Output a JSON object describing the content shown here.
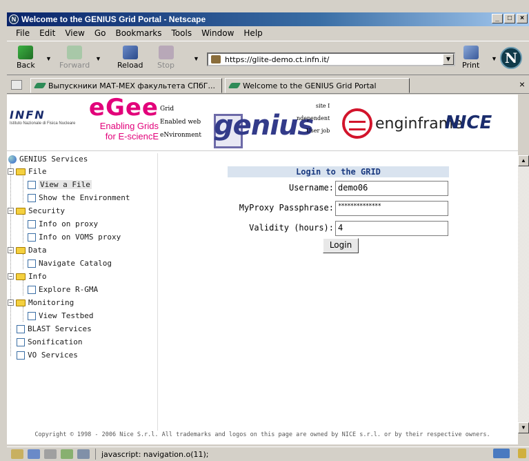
{
  "window": {
    "title": "Welcome to the GENIUS Grid Portal - Netscape",
    "buttons": [
      "_",
      "□",
      "×"
    ]
  },
  "menu": [
    "File",
    "Edit",
    "View",
    "Go",
    "Bookmarks",
    "Tools",
    "Window",
    "Help"
  ],
  "toolbar": {
    "back": "Back",
    "forward": "Forward",
    "reload": "Reload",
    "stop": "Stop",
    "url": "https://glite-demo.ct.infn.it/",
    "print": "Print"
  },
  "tabs": [
    {
      "label": "Выпускники МАТ-МЕХ факультета СПбГ...",
      "active": false
    },
    {
      "label": "Welcome to the GENIUS Grid Portal",
      "active": true
    }
  ],
  "banner": {
    "infn": "INFN",
    "infn_small": "Istituto Nazionale di Fisica Nucleare",
    "egee": "eGee",
    "egee_line1": "Enabling Grids",
    "egee_line2": "for E-sciencE",
    "grid_words": [
      "Grid",
      "Enabled web",
      "eNvironment"
    ],
    "genius": "genius",
    "site_words": [
      "site I",
      "ndependent",
      "User job"
    ],
    "enginframe": "enginframe",
    "nice": "NICE"
  },
  "sidebar": {
    "root": "GENIUS Services",
    "items": [
      {
        "label": "File",
        "type": "folder",
        "level": 1
      },
      {
        "label": "View a File",
        "type": "doc",
        "level": 2,
        "selected": true
      },
      {
        "label": "Show the Environment",
        "type": "doc",
        "level": 2
      },
      {
        "label": "Security",
        "type": "folder",
        "level": 1
      },
      {
        "label": "Info on proxy",
        "type": "doc",
        "level": 2
      },
      {
        "label": "Info on VOMS proxy",
        "type": "doc",
        "level": 2
      },
      {
        "label": "Data",
        "type": "folder",
        "level": 1
      },
      {
        "label": "Navigate Catalog",
        "type": "doc",
        "level": 2
      },
      {
        "label": "Info",
        "type": "folder",
        "level": 1
      },
      {
        "label": "Explore R-GMA",
        "type": "doc",
        "level": 2
      },
      {
        "label": "Monitoring",
        "type": "folder",
        "level": 1
      },
      {
        "label": "View Testbed",
        "type": "doc",
        "level": 2
      },
      {
        "label": "BLAST Services",
        "type": "doc",
        "level": 1
      },
      {
        "label": "Sonification",
        "type": "doc",
        "level": 1
      },
      {
        "label": "VO Services",
        "type": "doc",
        "level": 1
      }
    ]
  },
  "login": {
    "title": "Login to the GRID",
    "username_label": "Username:",
    "username_value": "demo06",
    "passphrase_label": "MyProxy Passphrase:",
    "passphrase_value": "**************",
    "validity_label": "Validity (hours):",
    "validity_value": "4",
    "button": "Login"
  },
  "footer": {
    "copyright": "Copyright © 1998 - 2006 Nice S.r.l. All trademarks and logos on this page are owned by NICE s.r.l. or by their respective owners."
  },
  "status": {
    "text": "javascript: navigation.o(11);"
  }
}
